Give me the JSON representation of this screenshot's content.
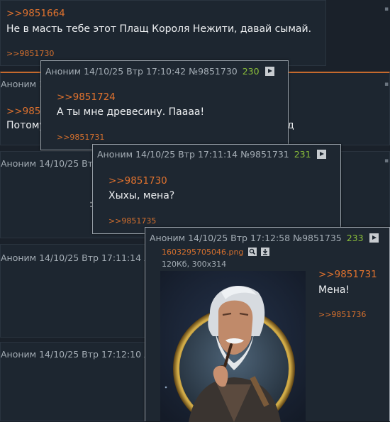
{
  "post_top": {
    "quote": ">>9851664",
    "text": "Не в масть тебе этот Плащ Короля Нежити, давай сымай.",
    "reply": ">>9851730"
  },
  "post_bg2": {
    "author": "Аноним 14",
    "quote": ">>9850",
    "text": "Потому",
    "tail": "д"
  },
  "post_bg3": {
    "header": "Аноним 14/10/25 Втр"
  },
  "post_bg4": {
    "header": "Аноним 14/10/25 Втр 17:11:14 №"
  },
  "post_bg5": {
    "header": "Аноним 14/10/25 Втр 17:12:10 №"
  },
  "popup1": {
    "header": "Аноним 14/10/25 Втр 17:10:42 №9851730",
    "count": "230",
    "quote": ">>9851724",
    "text": "А ты мне древесину. Паааа!",
    "reply": ">>9851731"
  },
  "popup2": {
    "header": "Аноним 14/10/25 Втр 17:11:14 №9851731",
    "count": "231",
    "quote": ">>9851730",
    "text": "Хыхы, мена?",
    "reply": ">>9851735"
  },
  "popup3": {
    "header": "Аноним 14/10/25 Втр 17:12:58 №9851735",
    "count": "233",
    "filename": "1603295705046.png",
    "filemeta": "120Кб, 300x314",
    "quote": ">>9851731",
    "text": "Мена!",
    "reply": ">>9851736"
  },
  "colors": {
    "link": "#e0722e",
    "count": "#8bbf3a",
    "header": "#a4adb5"
  },
  "icons": [
    "play-icon",
    "search-icon",
    "download-icon"
  ]
}
